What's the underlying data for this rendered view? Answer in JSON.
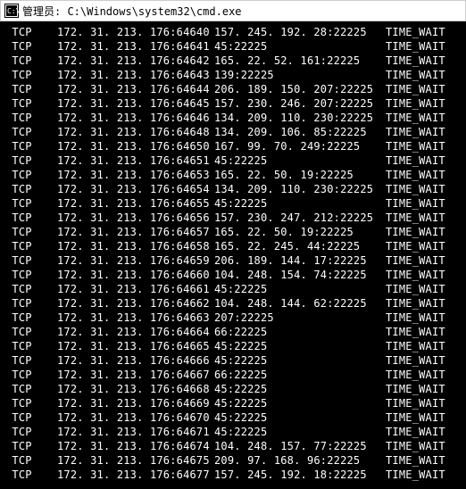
{
  "window": {
    "title": "管理员: C:\\Windows\\system32\\cmd.exe"
  },
  "rows": [
    {
      "proto": "TCP",
      "local": "172.31.213.176:64640",
      "remote": "157.245.192.28:22225",
      "state": "TIME_WAIT"
    },
    {
      "proto": "TCP",
      "local": "172.31.213.176:64641",
      "remote": "45:22225",
      "state": "TIME_WAIT"
    },
    {
      "proto": "TCP",
      "local": "172.31.213.176:64642",
      "remote": "165.22.52.161:22225",
      "state": "TIME_WAIT"
    },
    {
      "proto": "TCP",
      "local": "172.31.213.176:64643",
      "remote": "139:22225",
      "state": "TIME_WAIT"
    },
    {
      "proto": "TCP",
      "local": "172.31.213.176:64644",
      "remote": "206.189.150.207:22225",
      "state": "TIME_WAIT"
    },
    {
      "proto": "TCP",
      "local": "172.31.213.176:64645",
      "remote": "157.230.246.207:22225",
      "state": "TIME_WAIT"
    },
    {
      "proto": "TCP",
      "local": "172.31.213.176:64646",
      "remote": "134.209.110.230:22225",
      "state": "TIME_WAIT"
    },
    {
      "proto": "TCP",
      "local": "172.31.213.176:64648",
      "remote": "134.209.106.85:22225",
      "state": "TIME_WAIT"
    },
    {
      "proto": "TCP",
      "local": "172.31.213.176:64650",
      "remote": "167.99.70.249:22225",
      "state": "TIME_WAIT"
    },
    {
      "proto": "TCP",
      "local": "172.31.213.176:64651",
      "remote": "45:22225",
      "state": "TIME_WAIT"
    },
    {
      "proto": "TCP",
      "local": "172.31.213.176:64653",
      "remote": "165.22.50.19:22225",
      "state": "TIME_WAIT"
    },
    {
      "proto": "TCP",
      "local": "172.31.213.176:64654",
      "remote": "134.209.110.230:22225",
      "state": "TIME_WAIT"
    },
    {
      "proto": "TCP",
      "local": "172.31.213.176:64655",
      "remote": "45:22225",
      "state": "TIME_WAIT"
    },
    {
      "proto": "TCP",
      "local": "172.31.213.176:64656",
      "remote": "157.230.247.212:22225",
      "state": "TIME_WAIT"
    },
    {
      "proto": "TCP",
      "local": "172.31.213.176:64657",
      "remote": "165.22.50.19:22225",
      "state": "TIME_WAIT"
    },
    {
      "proto": "TCP",
      "local": "172.31.213.176:64658",
      "remote": "165.22.245.44:22225",
      "state": "TIME_WAIT"
    },
    {
      "proto": "TCP",
      "local": "172.31.213.176:64659",
      "remote": "206.189.144.17:22225",
      "state": "TIME_WAIT"
    },
    {
      "proto": "TCP",
      "local": "172.31.213.176:64660",
      "remote": "104.248.154.74:22225",
      "state": "TIME_WAIT"
    },
    {
      "proto": "TCP",
      "local": "172.31.213.176:64661",
      "remote": "45:22225",
      "state": "TIME_WAIT"
    },
    {
      "proto": "TCP",
      "local": "172.31.213.176:64662",
      "remote": "104.248.144.62:22225",
      "state": "TIME_WAIT"
    },
    {
      "proto": "TCP",
      "local": "172.31.213.176:64663",
      "remote": "207:22225",
      "state": "TIME_WAIT"
    },
    {
      "proto": "TCP",
      "local": "172.31.213.176:64664",
      "remote": "66:22225",
      "state": "TIME_WAIT"
    },
    {
      "proto": "TCP",
      "local": "172.31.213.176:64665",
      "remote": "45:22225",
      "state": "TIME_WAIT"
    },
    {
      "proto": "TCP",
      "local": "172.31.213.176:64666",
      "remote": "45:22225",
      "state": "TIME_WAIT"
    },
    {
      "proto": "TCP",
      "local": "172.31.213.176:64667",
      "remote": "66:22225",
      "state": "TIME_WAIT"
    },
    {
      "proto": "TCP",
      "local": "172.31.213.176:64668",
      "remote": "45:22225",
      "state": "TIME_WAIT"
    },
    {
      "proto": "TCP",
      "local": "172.31.213.176:64669",
      "remote": "45:22225",
      "state": "TIME_WAIT"
    },
    {
      "proto": "TCP",
      "local": "172.31.213.176:64670",
      "remote": "45:22225",
      "state": "TIME_WAIT"
    },
    {
      "proto": "TCP",
      "local": "172.31.213.176:64671",
      "remote": "45:22225",
      "state": "TIME_WAIT"
    },
    {
      "proto": "TCP",
      "local": "172.31.213.176:64674",
      "remote": "104.248.157.77:22225",
      "state": "TIME_WAIT"
    },
    {
      "proto": "TCP",
      "local": "172.31.213.176:64675",
      "remote": "209.97.168.96:22225",
      "state": "TIME_WAIT"
    },
    {
      "proto": "TCP",
      "local": "172.31.213.176:64677",
      "remote": "157.245.192.18:22225",
      "state": "TIME_WAIT"
    }
  ]
}
